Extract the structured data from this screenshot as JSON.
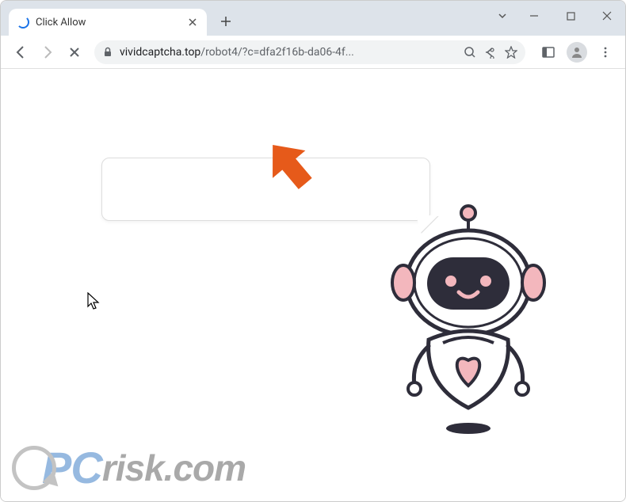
{
  "window": {
    "tab_title": "Click Allow"
  },
  "address_bar": {
    "domain": "vividcaptcha.top",
    "path": "/robot4/?c=dfa2f16b-da06-4f..."
  },
  "watermark": {
    "text_prefix": "P",
    "text_mid": "C",
    "text_suffix": "risk.com"
  },
  "icons": {
    "loading": "loading-spinner",
    "close_tab": "close-icon",
    "new_tab": "plus-icon",
    "dropdown": "chevron-down-icon",
    "minimize": "minimize-icon",
    "maximize": "maximize-icon",
    "close_window": "close-icon",
    "back": "back-arrow-icon",
    "forward": "forward-arrow-icon",
    "stop": "stop-icon",
    "lock": "lock-icon",
    "zoom": "search-icon",
    "share": "share-icon",
    "star": "star-icon",
    "side_panel": "side-panel-icon",
    "profile": "profile-icon",
    "menu": "menu-dots-icon",
    "pointer_arrow": "orange-arrow-annotation",
    "robot": "robot-mascot",
    "cursor": "mouse-cursor"
  },
  "colors": {
    "accent": "#1a73e8",
    "arrow": "#e65a1a",
    "robot_pink": "#f3b7bd",
    "robot_dark": "#2e2d3a"
  }
}
